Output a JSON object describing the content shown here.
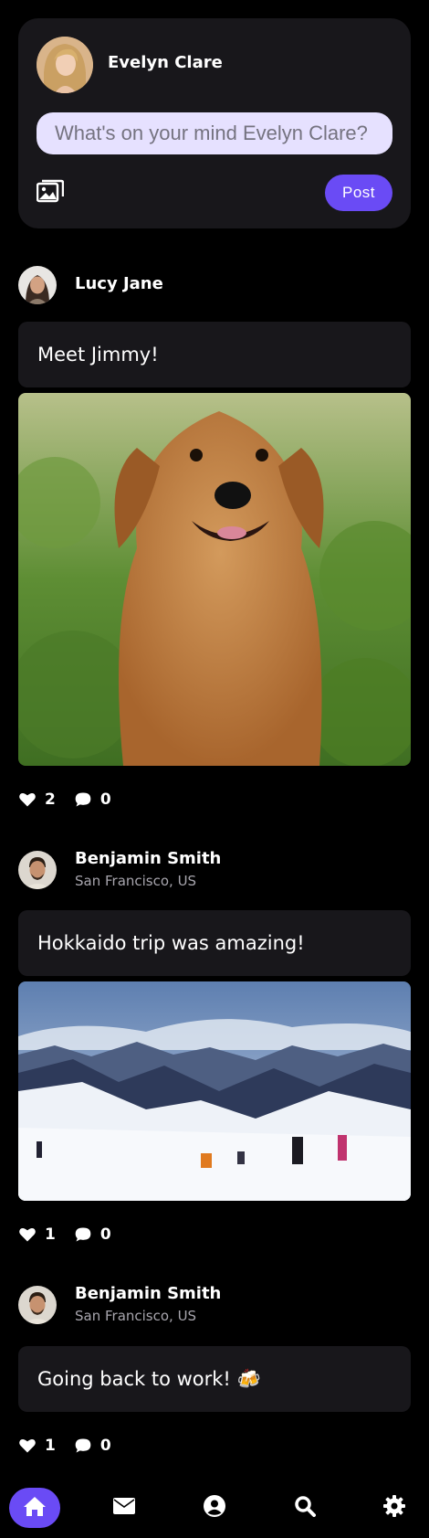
{
  "composer": {
    "user_name": "Evelyn Clare",
    "placeholder": "What's on your mind Evelyn Clare?",
    "post_label": "Post"
  },
  "posts": [
    {
      "author": "Lucy Jane",
      "location": "",
      "text": "Meet Jimmy!",
      "image": "dog-photo",
      "likes": "2",
      "comments": "0"
    },
    {
      "author": "Benjamin Smith",
      "location": "San Francisco, US",
      "text": "Hokkaido trip was amazing!",
      "image": "ski-slope-photo",
      "likes": "1",
      "comments": "0"
    },
    {
      "author": "Benjamin Smith",
      "location": "San Francisco, US",
      "text": "Going back to work! 🍻",
      "image": "",
      "likes": "1",
      "comments": "0"
    }
  ],
  "nav": {
    "items": [
      "home-icon",
      "envelope-icon",
      "user-circle-icon",
      "search-icon",
      "gear-icon"
    ],
    "active": "home-icon"
  },
  "colors": {
    "background": "#000000",
    "card": "#18171b",
    "accent": "#6a4bf5",
    "input_bg": "#e6e1ff"
  }
}
